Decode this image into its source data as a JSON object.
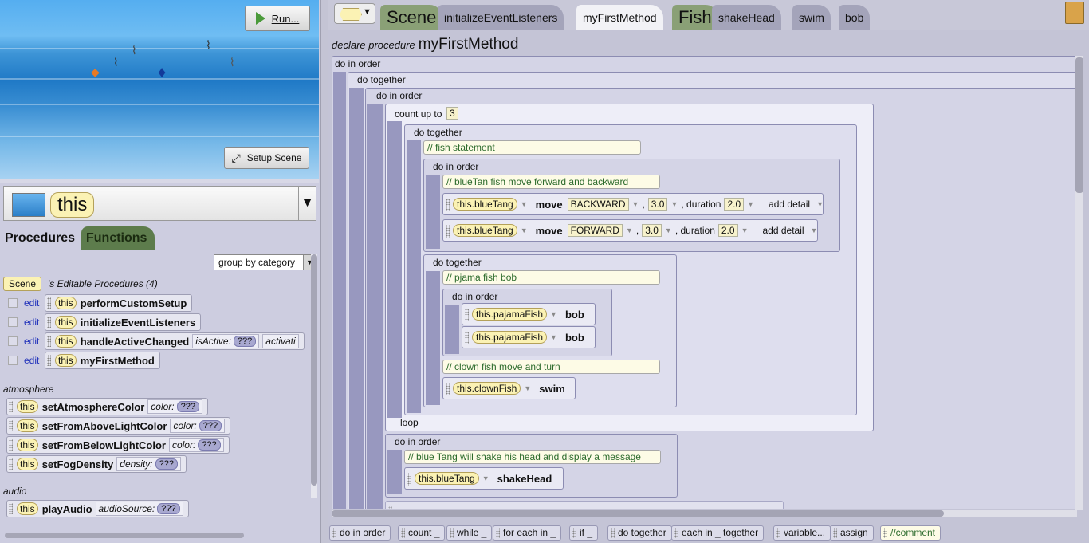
{
  "scene": {
    "run_label": "Run...",
    "setup_label": "Setup Scene"
  },
  "selector": {
    "value": "this"
  },
  "left_tabs": {
    "procedures": "Procedures",
    "functions": "Functions"
  },
  "group_by": "group by category",
  "editable": {
    "scene_chip": "Scene",
    "title": "'s Editable Procedures (4)",
    "edit_label": "edit",
    "this_label": "this"
  },
  "procedures": [
    {
      "name": "performCustomSetup"
    },
    {
      "name": "initializeEventListeners"
    },
    {
      "name": "handleActiveChanged",
      "param1": "isActive:",
      "q": "???",
      "param2": "activati"
    },
    {
      "name": "myFirstMethod"
    }
  ],
  "categories": {
    "atmosphere": "atmosphere",
    "audio": "audio"
  },
  "atmosphere_items": [
    {
      "name": "setAtmosphereColor",
      "param": "color:",
      "q": "???"
    },
    {
      "name": "setFromAboveLightColor",
      "param": "color:",
      "q": "???"
    },
    {
      "name": "setFromBelowLightColor",
      "param": "color:",
      "q": "???"
    },
    {
      "name": "setFogDensity",
      "param": "density:",
      "q": "???"
    }
  ],
  "audio_items": [
    {
      "name": "playAudio",
      "param": "audioSource:",
      "q": "???"
    }
  ],
  "tabs": {
    "scene": "Scene",
    "initialize": "initializeEventListeners",
    "myfirst": "myFirstMethod",
    "fish": "Fish",
    "shake": "shakeHead",
    "swim": "swim",
    "bob": "bob"
  },
  "declare": {
    "prefix": "declare procedure",
    "name": "myFirstMethod"
  },
  "code": {
    "do_in_order": "do in order",
    "do_together": "do together",
    "count_up_to": "count up to",
    "count": "3",
    "loop": "loop",
    "cmt_fish": "// fish statement",
    "cmt_bluetan": "// blueTan fish move forward and backward",
    "cmt_pjama": "// pjama fish bob",
    "cmt_clown": "// clown fish move and turn",
    "cmt_shake": "// blue Tang will shake his head and display a message",
    "blueTang": "this.blueTang",
    "pajamaFish": "this.pajamaFish",
    "clownFish": "this.clownFish",
    "move": "move",
    "backward": "BACKWARD",
    "forward": "FORWARD",
    "amount": "3.0",
    "duration_label": ", duration",
    "duration": "2.0",
    "add_detail": "add detail",
    "bob": "bob",
    "swim": "swim",
    "shakeHead": "shakeHead"
  },
  "palette": [
    "do in order",
    "count _",
    "while _",
    "for each in _",
    "if _",
    "do together",
    "each in _ together",
    "variable...",
    "assign",
    "//comment"
  ]
}
